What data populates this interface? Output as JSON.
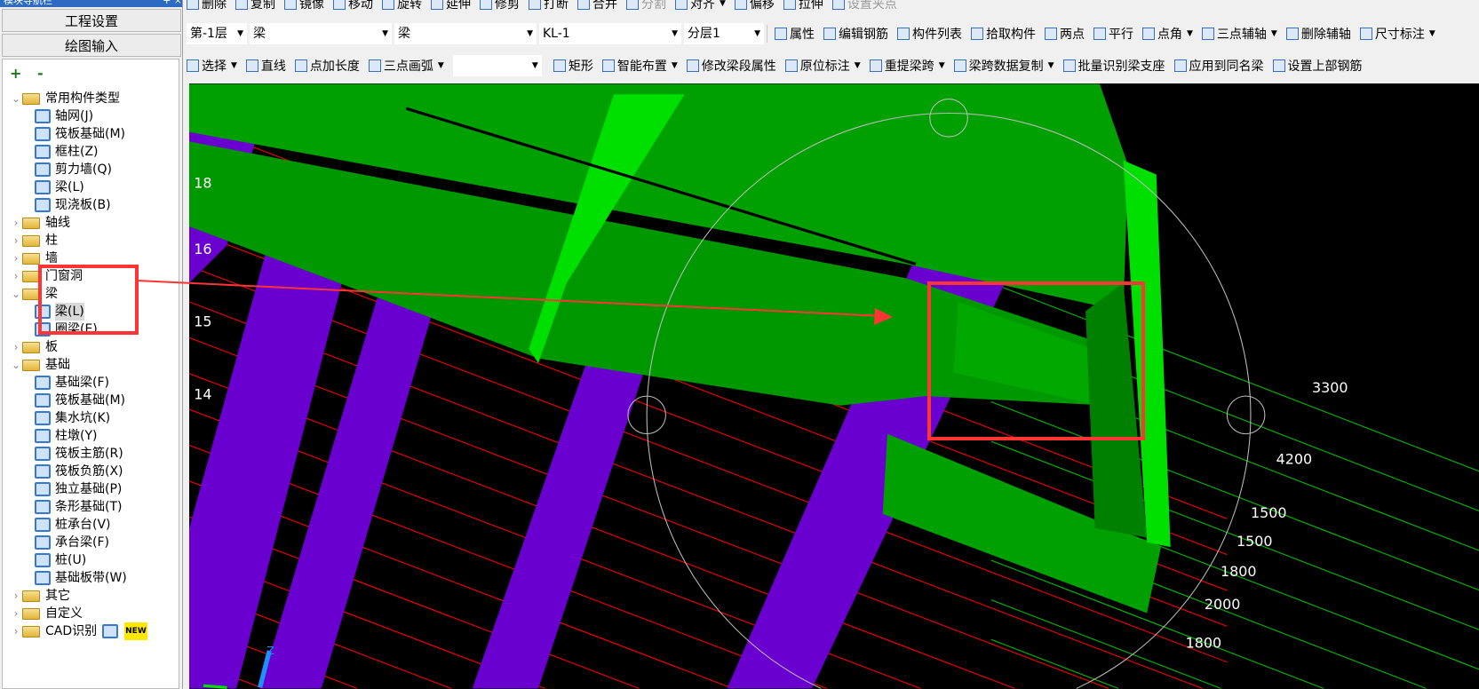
{
  "sidebar": {
    "title": "模块导航栏",
    "title_buttons": [
      "+",
      "×"
    ],
    "project_settings": "工程设置",
    "drawing_input": "绘图输入",
    "expand_collapse": "+ -",
    "tree": [
      {
        "label": "常用构件类型",
        "level": 0,
        "expanded": true
      },
      {
        "label": "轴网(J)",
        "level": 1,
        "icon": "axis-grid-icon"
      },
      {
        "label": "筏板基础(M)",
        "level": 1,
        "icon": "raft-foundation-icon"
      },
      {
        "label": "框柱(Z)",
        "level": 1,
        "icon": "column-icon"
      },
      {
        "label": "剪力墙(Q)",
        "level": 1,
        "icon": "shear-wall-icon"
      },
      {
        "label": "梁(L)",
        "level": 1,
        "icon": "beam-icon"
      },
      {
        "label": "现浇板(B)",
        "level": 1,
        "icon": "slab-icon"
      },
      {
        "label": "轴线",
        "level": 0,
        "expanded": false
      },
      {
        "label": "柱",
        "level": 0,
        "expanded": false
      },
      {
        "label": "墙",
        "level": 0,
        "expanded": false
      },
      {
        "label": "门窗洞",
        "level": 0,
        "expanded": false
      },
      {
        "label": "梁",
        "level": 0,
        "expanded": true
      },
      {
        "label": "梁(L)",
        "level": 1,
        "icon": "beam-icon",
        "selected": true
      },
      {
        "label": "圈梁(E)",
        "level": 1,
        "icon": "ring-beam-icon"
      },
      {
        "label": "板",
        "level": 0,
        "expanded": false
      },
      {
        "label": "基础",
        "level": 0,
        "expanded": true
      },
      {
        "label": "基础梁(F)",
        "level": 1,
        "icon": "foundation-beam-icon"
      },
      {
        "label": "筏板基础(M)",
        "level": 1,
        "icon": "raft-foundation-icon"
      },
      {
        "label": "集水坑(K)",
        "level": 1,
        "icon": "sump-icon"
      },
      {
        "label": "柱墩(Y)",
        "level": 1,
        "icon": "column-pier-icon"
      },
      {
        "label": "筏板主筋(R)",
        "level": 1,
        "icon": "raft-main-rebar-icon"
      },
      {
        "label": "筏板负筋(X)",
        "level": 1,
        "icon": "raft-negative-rebar-icon"
      },
      {
        "label": "独立基础(P)",
        "level": 1,
        "icon": "isolated-footing-icon"
      },
      {
        "label": "条形基础(T)",
        "level": 1,
        "icon": "strip-footing-icon"
      },
      {
        "label": "桩承台(V)",
        "level": 1,
        "icon": "pile-cap-icon"
      },
      {
        "label": "承台梁(F)",
        "level": 1,
        "icon": "cap-beam-icon"
      },
      {
        "label": "桩(U)",
        "level": 1,
        "icon": "pile-icon"
      },
      {
        "label": "基础板带(W)",
        "level": 1,
        "icon": "foundation-strip-icon"
      },
      {
        "label": "其它",
        "level": 0,
        "expanded": false
      },
      {
        "label": "自定义",
        "level": 0,
        "expanded": false
      },
      {
        "label": "CAD识别",
        "level": 0,
        "expanded": false,
        "badge": "NEW"
      }
    ]
  },
  "toolbar1": [
    {
      "label": "删除"
    },
    {
      "label": "复制"
    },
    {
      "label": "镜像"
    },
    {
      "label": "移动"
    },
    {
      "label": "旋转"
    },
    {
      "label": "延伸"
    },
    {
      "label": "修剪"
    },
    {
      "label": "打断"
    },
    {
      "label": "合并"
    },
    {
      "label": "分割",
      "disabled": true
    },
    {
      "label": "对齐",
      "dropdown": true
    },
    {
      "label": "偏移"
    },
    {
      "label": "拉伸"
    },
    {
      "label": "设置夹点",
      "disabled": true
    }
  ],
  "toolbar2": {
    "selects": [
      "第-1层",
      "梁",
      "梁",
      "KL-1",
      "分层1"
    ],
    "items": [
      {
        "label": "属性"
      },
      {
        "label": "编辑钢筋"
      },
      {
        "label": "构件列表"
      },
      {
        "label": "拾取构件"
      },
      {
        "label": "两点"
      },
      {
        "label": "平行"
      },
      {
        "label": "点角",
        "dropdown": true
      },
      {
        "label": "三点辅轴",
        "dropdown": true
      },
      {
        "label": "删除辅轴"
      },
      {
        "label": "尺寸标注",
        "dropdown": true
      }
    ]
  },
  "toolbar3": [
    {
      "label": "选择",
      "dropdown": true
    },
    {
      "label": "直线"
    },
    {
      "label": "点加长度"
    },
    {
      "label": "三点画弧",
      "dropdown": true
    },
    {
      "label": "",
      "dropdown": true,
      "select": true
    },
    {
      "label": "矩形"
    },
    {
      "label": "智能布置",
      "dropdown": true
    },
    {
      "label": "修改梁段属性"
    },
    {
      "label": "原位标注",
      "dropdown": true
    },
    {
      "label": "重提梁跨",
      "dropdown": true
    },
    {
      "label": "梁跨数据复制",
      "dropdown": true
    },
    {
      "label": "批量识别梁支座"
    },
    {
      "label": "应用到同名梁"
    },
    {
      "label": "设置上部钢筋"
    }
  ],
  "canvas": {
    "axis_labels_left": [
      "18",
      "16",
      "15",
      "14"
    ],
    "dimension_labels": [
      "3300",
      "4200",
      "1500",
      "1500",
      "1800",
      "2000",
      "1800"
    ],
    "coordinate_axis": "Z",
    "colors": {
      "beam": "#00a000",
      "beam_highlight": "#00e000",
      "column": "#6a00d0",
      "grid_red": "#ff0000",
      "grid_green": "#00c000",
      "annotation": "#ff3030"
    }
  }
}
